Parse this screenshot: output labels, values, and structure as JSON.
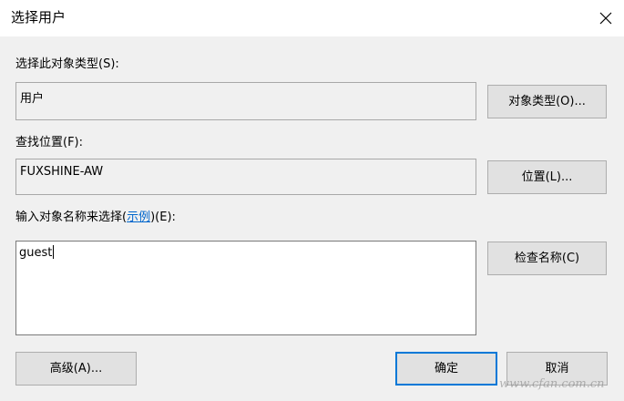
{
  "window": {
    "title": "选择用户"
  },
  "object_type": {
    "label": "选择此对象类型(S):",
    "value": "用户",
    "button": "对象类型(O)..."
  },
  "location": {
    "label": "查找位置(F):",
    "value": "FUXSHINE-AW",
    "button": "位置(L)..."
  },
  "names": {
    "label_prefix": "输入对象名称来选择(",
    "label_link": "示例",
    "label_suffix": ")(E):",
    "value": "guest",
    "check_button": "检查名称(C)"
  },
  "footer": {
    "advanced": "高级(A)...",
    "ok": "确定",
    "cancel": "取消"
  },
  "watermark": "www.cfan.com.cn",
  "icons": {
    "close": "close-icon"
  },
  "colors": {
    "accent": "#0078d7",
    "link": "#0066cc"
  }
}
